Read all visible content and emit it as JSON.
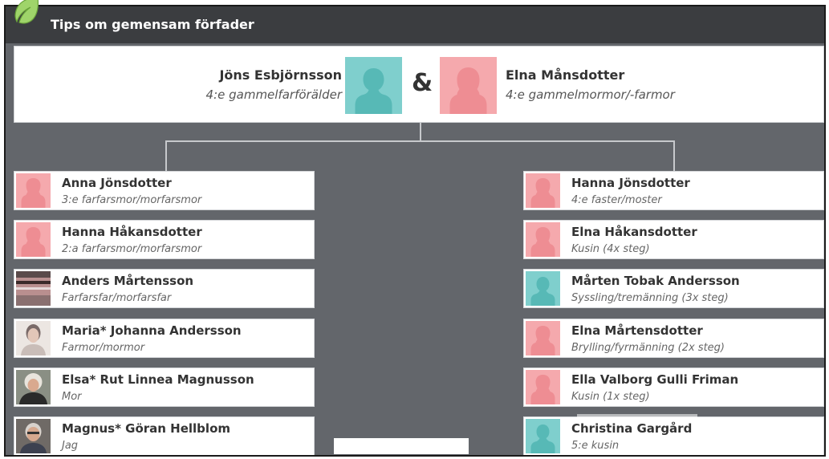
{
  "header": {
    "title": "Tips om gemensam förfader",
    "icon": "leaf-icon"
  },
  "couple": {
    "left": {
      "name": "Jöns Esbjörnsson",
      "relation": "4:e gammelfarförälder",
      "gender": "male"
    },
    "ampersand": "&",
    "right": {
      "name": "Elna Månsdotter",
      "relation": "4:e gammelmormor/-farmor",
      "gender": "female"
    }
  },
  "left_branch": [
    {
      "name": "Anna Jönsdotter",
      "relation": "3:e farfarsmor/morfarsmor",
      "avatar": "female-silhouette"
    },
    {
      "name": "Hanna Håkansdotter",
      "relation": "2:a farfarsmor/morfarsmor",
      "avatar": "female-silhouette"
    },
    {
      "name": "Anders Mårtensson",
      "relation": "Farfarsfar/morfarsfar",
      "avatar": "photo"
    },
    {
      "name": "Maria* Johanna Andersson",
      "relation": "Farmor/mormor",
      "avatar": "photo"
    },
    {
      "name": "Elsa* Rut Linnea Magnusson",
      "relation": "Mor",
      "avatar": "photo"
    },
    {
      "name": "Magnus* Göran Hellblom",
      "relation": "Jag",
      "avatar": "photo"
    }
  ],
  "right_branch": [
    {
      "name": "Hanna Jönsdotter",
      "relation": "4:e faster/moster",
      "avatar": "female-silhouette"
    },
    {
      "name": "Elna Håkansdotter",
      "relation": "Kusin (4x steg)",
      "avatar": "female-silhouette"
    },
    {
      "name": "Mårten Tobak Andersson",
      "relation": "Syssling/tremänning (3x steg)",
      "avatar": "male-silhouette"
    },
    {
      "name": "Elna Mårtensdotter",
      "relation": "Brylling/fyrmänning (2x steg)",
      "avatar": "female-silhouette"
    },
    {
      "name": "Ella Valborg Gulli Friman",
      "relation": "Kusin (1x steg)",
      "avatar": "female-silhouette"
    },
    {
      "name": "Christina Gargård",
      "relation": "5:e kusin",
      "avatar": "male-silhouette"
    }
  ],
  "colors": {
    "male": "#7fcfcd",
    "female": "#f5a9ad",
    "panel": "#63666b",
    "header": "#3b3d40"
  }
}
